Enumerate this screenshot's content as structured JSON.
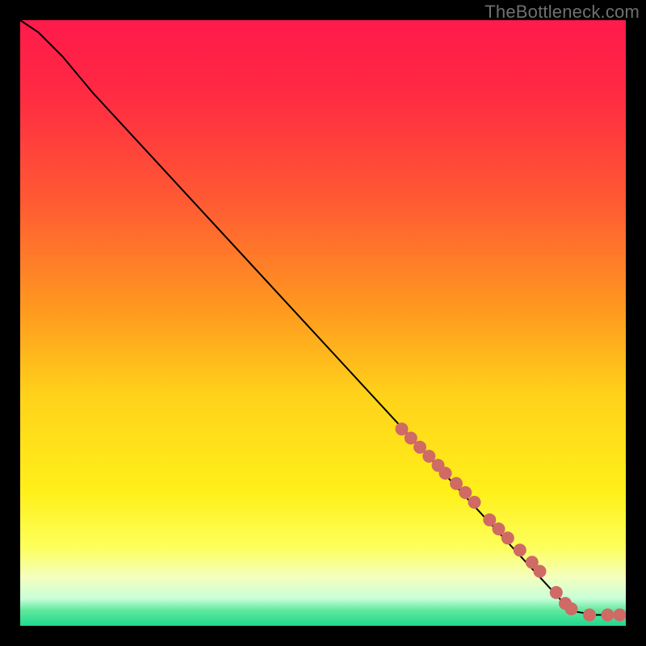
{
  "watermark": "TheBottleneck.com",
  "colors": {
    "gradient_stops": [
      {
        "offset": 0.0,
        "color": "#ff1a4b"
      },
      {
        "offset": 0.12,
        "color": "#ff2a43"
      },
      {
        "offset": 0.3,
        "color": "#ff5a33"
      },
      {
        "offset": 0.48,
        "color": "#ff9a1f"
      },
      {
        "offset": 0.62,
        "color": "#ffd21a"
      },
      {
        "offset": 0.78,
        "color": "#fff01a"
      },
      {
        "offset": 0.87,
        "color": "#fdff5c"
      },
      {
        "offset": 0.92,
        "color": "#f4ffbf"
      },
      {
        "offset": 0.955,
        "color": "#c8ffd8"
      },
      {
        "offset": 0.975,
        "color": "#5de89c"
      },
      {
        "offset": 1.0,
        "color": "#1fd98e"
      }
    ],
    "curve": "#000000",
    "marker_fill": "#cf6a65",
    "marker_stroke": "#b85a56"
  },
  "chart_data": {
    "type": "line",
    "title": "",
    "xlabel": "",
    "ylabel": "",
    "xlim": [
      0,
      100
    ],
    "ylim": [
      0,
      100
    ],
    "curve": [
      {
        "x": 0,
        "y": 100
      },
      {
        "x": 3,
        "y": 98
      },
      {
        "x": 7,
        "y": 94
      },
      {
        "x": 12,
        "y": 88
      },
      {
        "x": 90,
        "y": 3.5
      },
      {
        "x": 92,
        "y": 2.3
      },
      {
        "x": 95,
        "y": 1.8
      },
      {
        "x": 100,
        "y": 1.8
      }
    ],
    "markers": [
      {
        "x": 63.0,
        "y": 32.5
      },
      {
        "x": 64.5,
        "y": 31.0
      },
      {
        "x": 66.0,
        "y": 29.5
      },
      {
        "x": 67.5,
        "y": 28.0
      },
      {
        "x": 69.0,
        "y": 26.5
      },
      {
        "x": 70.2,
        "y": 25.2
      },
      {
        "x": 72.0,
        "y": 23.5
      },
      {
        "x": 73.5,
        "y": 22.0
      },
      {
        "x": 75.0,
        "y": 20.4
      },
      {
        "x": 77.5,
        "y": 17.5
      },
      {
        "x": 79.0,
        "y": 16.0
      },
      {
        "x": 80.5,
        "y": 14.5
      },
      {
        "x": 82.5,
        "y": 12.5
      },
      {
        "x": 84.5,
        "y": 10.5
      },
      {
        "x": 85.8,
        "y": 9.0
      },
      {
        "x": 88.5,
        "y": 5.5
      },
      {
        "x": 90.0,
        "y": 3.7
      },
      {
        "x": 91.0,
        "y": 2.8
      },
      {
        "x": 94.0,
        "y": 1.8
      },
      {
        "x": 97.0,
        "y": 1.8
      },
      {
        "x": 99.0,
        "y": 1.8
      }
    ]
  }
}
